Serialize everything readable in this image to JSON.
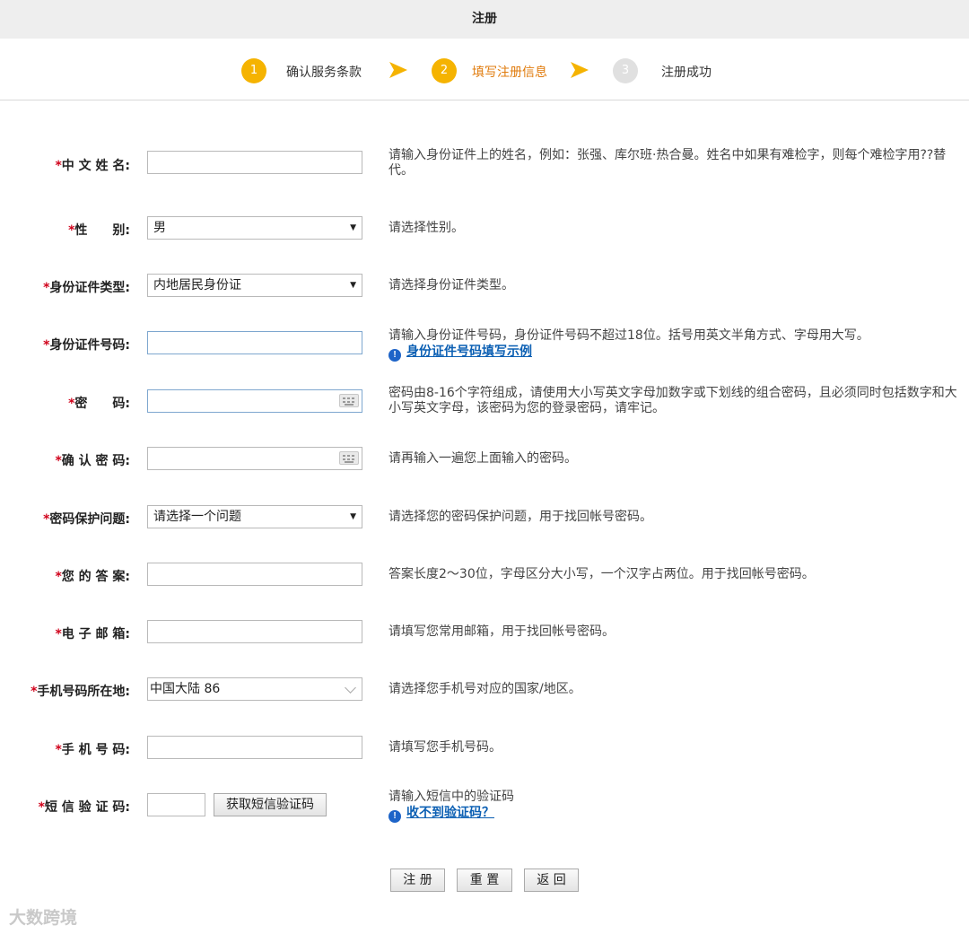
{
  "title": "注册",
  "steps": [
    {
      "num": "1",
      "label": "确认服务条款",
      "state": "done"
    },
    {
      "num": "2",
      "label": "填写注册信息",
      "state": "active"
    },
    {
      "num": "3",
      "label": "注册成功",
      "state": "pending"
    }
  ],
  "colors": {
    "step_active": "#f5b301",
    "step_pending": "#e0e0e0",
    "active_text": "#e07b0c",
    "required_star": "#d0021b",
    "link": "#0b5fb3"
  },
  "form": {
    "name": {
      "label": "中 文 姓 名:",
      "value": "",
      "hint": "请输入身份证件上的姓名，例如：张强、库尔班·热合曼。姓名中如果有难检字，则每个难检字用??替代。"
    },
    "gender": {
      "label": "性　　别:",
      "value": "男",
      "hint": "请选择性别。"
    },
    "id_type": {
      "label": "身份证件类型:",
      "value": "内地居民身份证",
      "hint": "请选择身份证件类型。"
    },
    "id_number": {
      "label": "身份证件号码:",
      "value": "",
      "hint": "请输入身份证件号码，身份证件号码不超过18位。括号用英文半角方式、字母用大写。",
      "link": "身份证件号码填写示例"
    },
    "password": {
      "label": "密　　码:",
      "value": "",
      "hint": "密码由8-16个字符组成，请使用大小写英文字母加数字或下划线的组合密码，且必须同时包括数字和大小写英文字母，该密码为您的登录密码，请牢记。"
    },
    "confirm_password": {
      "label": "确 认 密 码:",
      "value": "",
      "hint": "请再输入一遍您上面输入的密码。"
    },
    "security_question": {
      "label": "密码保护问题:",
      "value": "请选择一个问题",
      "hint": "请选择您的密码保护问题，用于找回帐号密码。"
    },
    "answer": {
      "label": "您 的 答 案:",
      "value": "",
      "hint": "答案长度2～30位，字母区分大小写，一个汉字占两位。用于找回帐号密码。"
    },
    "email": {
      "label": "电 子 邮 箱:",
      "value": "",
      "hint": "请填写您常用邮箱，用于找回帐号密码。"
    },
    "phone_region": {
      "label": "手机号码所在地:",
      "value": "中国大陆 86",
      "hint": "请选择您手机号对应的国家/地区。"
    },
    "phone": {
      "label": "手 机 号 码:",
      "value": "",
      "hint": "请填写您手机号码。"
    },
    "sms_code": {
      "label": "短 信 验 证 码:",
      "value": "",
      "button": "获取短信验证码",
      "hint": "请输入短信中的验证码",
      "link": "收不到验证码？"
    }
  },
  "buttons": {
    "submit": "注 册",
    "reset": "重 置",
    "back": "返 回"
  },
  "watermark": "大数跨境"
}
